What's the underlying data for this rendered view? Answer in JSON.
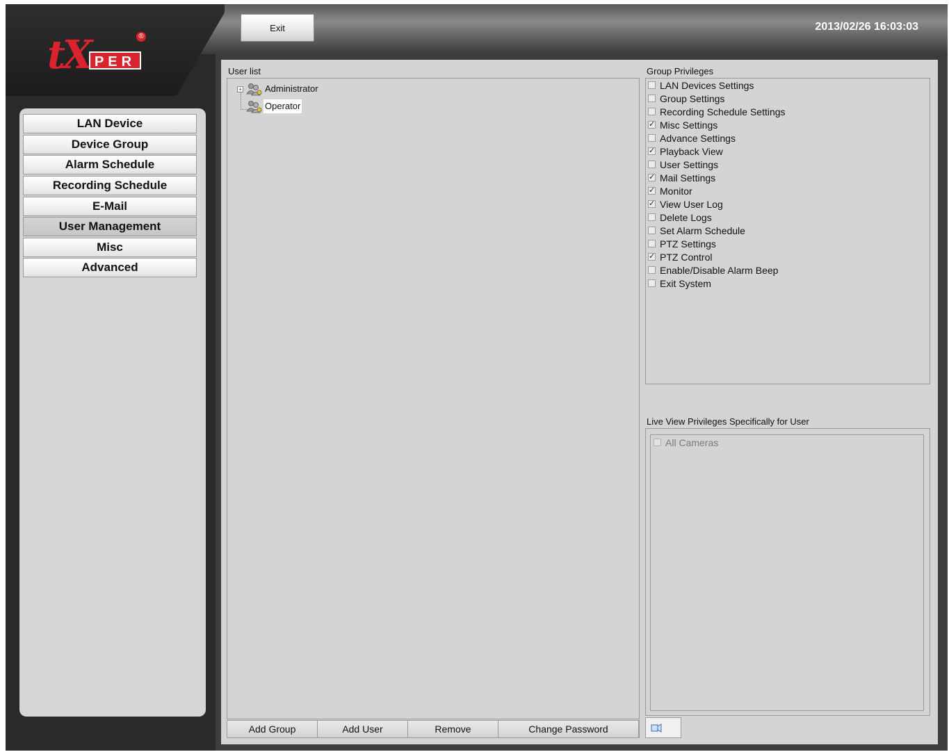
{
  "header": {
    "exit_label": "Exit",
    "datetime": "2013/02/26 16:03:03",
    "logo": {
      "tx": "tX",
      "per": "PER",
      "reg": "®"
    }
  },
  "sidebar": {
    "items": [
      {
        "label": "LAN Device",
        "active": false
      },
      {
        "label": "Device Group",
        "active": false
      },
      {
        "label": "Alarm Schedule",
        "active": false
      },
      {
        "label": "Recording Schedule",
        "active": false
      },
      {
        "label": "E-Mail",
        "active": false
      },
      {
        "label": "User Management",
        "active": true
      },
      {
        "label": "Misc",
        "active": false
      },
      {
        "label": "Advanced",
        "active": false
      }
    ]
  },
  "user_list": {
    "title": "User list",
    "nodes": [
      {
        "label": "Administrator",
        "expandable": true,
        "selected": false
      },
      {
        "label": "Operator",
        "expandable": false,
        "selected": true
      }
    ],
    "buttons": [
      "Add Group",
      "Add User",
      "Remove",
      "Change Password"
    ]
  },
  "group_privileges": {
    "title": "Group Privileges",
    "items": [
      {
        "label": "LAN Devices Settings",
        "checked": false
      },
      {
        "label": "Group Settings",
        "checked": false
      },
      {
        "label": "Recording Schedule Settings",
        "checked": false
      },
      {
        "label": "Misc Settings",
        "checked": true
      },
      {
        "label": "Advance Settings",
        "checked": false
      },
      {
        "label": "Playback View",
        "checked": true
      },
      {
        "label": "User Settings",
        "checked": false
      },
      {
        "label": "Mail Settings",
        "checked": true
      },
      {
        "label": "Monitor",
        "checked": true
      },
      {
        "label": "View User Log",
        "checked": true
      },
      {
        "label": "Delete Logs",
        "checked": false
      },
      {
        "label": "Set Alarm Schedule",
        "checked": false
      },
      {
        "label": "PTZ Settings",
        "checked": false
      },
      {
        "label": "PTZ Control",
        "checked": true
      },
      {
        "label": "Enable/Disable Alarm Beep",
        "checked": false
      },
      {
        "label": "Exit System",
        "checked": false
      }
    ]
  },
  "live_view": {
    "title": "Live View Privileges Specifically for User",
    "all_cameras_label": "All Cameras",
    "all_cameras_checked": false,
    "tab_icon": "camera-icon"
  }
}
